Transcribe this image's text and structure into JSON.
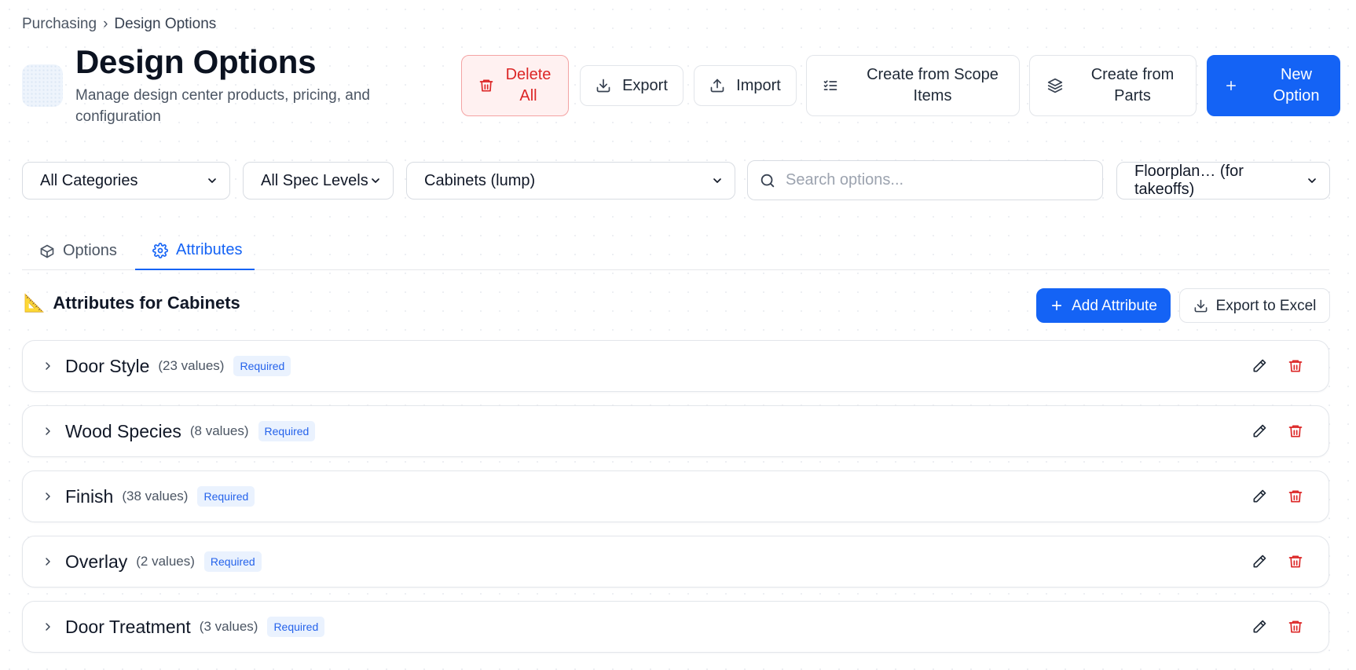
{
  "breadcrumb": {
    "parent": "Purchasing",
    "separator": "›",
    "current": "Design Options"
  },
  "header": {
    "title": "Design Options",
    "subtitle": "Manage design center products, pricing, and configuration"
  },
  "actions": {
    "delete_all": "Delete All",
    "export": "Export",
    "import": "Import",
    "create_from_scope": "Create from Scope Items",
    "create_from_parts": "Create from Parts",
    "new_option": "New Option"
  },
  "filters": {
    "category": "All Categories",
    "spec_level": "All Spec Levels",
    "group": "Cabinets (lump)",
    "search_placeholder": "Search options...",
    "floorplan": "Floorplan… (for takeoffs)"
  },
  "tabs": [
    {
      "label": "Options",
      "icon": "box-icon",
      "active": false
    },
    {
      "label": "Attributes",
      "icon": "gear-icon",
      "active": true
    }
  ],
  "section": {
    "icon": "📐",
    "title": "Attributes for Cabinets",
    "add_label": "Add Attribute",
    "export_label": "Export to Excel"
  },
  "attributes": [
    {
      "name": "Door Style",
      "count": "(23 values)",
      "badge": "Required"
    },
    {
      "name": "Wood Species",
      "count": "(8 values)",
      "badge": "Required"
    },
    {
      "name": "Finish",
      "count": "(38 values)",
      "badge": "Required"
    },
    {
      "name": "Overlay",
      "count": "(2 values)",
      "badge": "Required"
    },
    {
      "name": "Door Treatment",
      "count": "(3 values)",
      "badge": "Required"
    }
  ],
  "colors": {
    "primary": "#1463f5",
    "danger": "#dc2626",
    "badge_bg": "#eaf2fe"
  }
}
